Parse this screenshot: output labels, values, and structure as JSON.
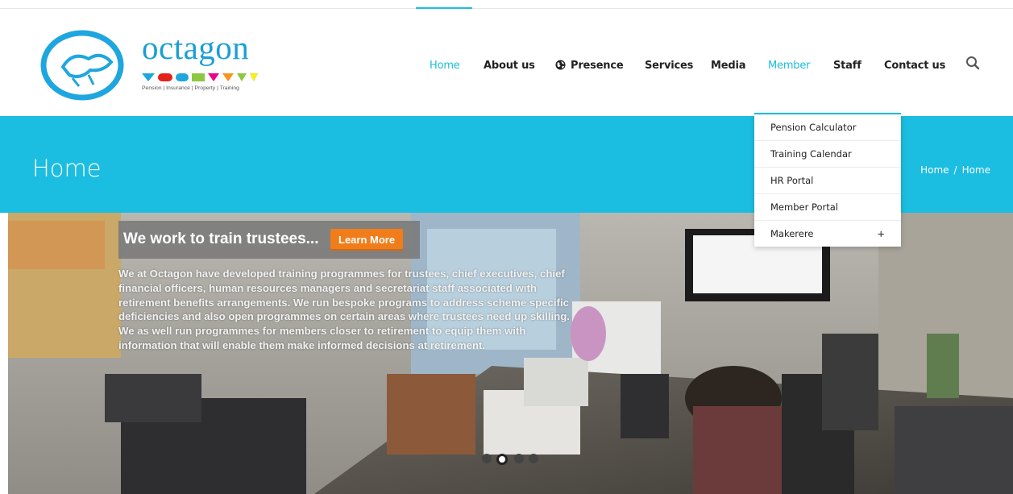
{
  "logo": {
    "word": "octagon",
    "tagline": "Pension | Insurance | Property | Training"
  },
  "nav": {
    "items": [
      {
        "label": "Home"
      },
      {
        "label": "About us"
      },
      {
        "label": "Presence",
        "icon": "globe-icon"
      },
      {
        "label": "Services"
      },
      {
        "label": "Media"
      },
      {
        "label": "Member"
      },
      {
        "label": "Staff"
      },
      {
        "label": "Contact us"
      }
    ],
    "search_icon": "search-icon"
  },
  "band": {
    "title": "Home",
    "breadcrumb": [
      "Home",
      "Home"
    ],
    "separator": "/"
  },
  "dropdown": {
    "items": [
      {
        "label": "Pension Calculator"
      },
      {
        "label": "Training Calendar"
      },
      {
        "label": "HR Portal"
      },
      {
        "label": "Member Portal"
      },
      {
        "label": "Makerere",
        "expand": "+"
      }
    ]
  },
  "slider": {
    "title": "We work to train trustees...",
    "button_label": "Learn More",
    "body": "We at Octagon have developed training programmes for trustees, chief executives, chief financial officers, human resources managers and secretariat staff associated with retirement benefits arrangements. We run bespoke programs to address scheme specific deficiencies and also open programmes on certain areas where trustees need up skilling. We as well run programmes for members closer to retirement to equip them with information that will enable them make informed decisions at retirement.",
    "dots": 4,
    "active_dot": 2
  },
  "colors": {
    "accent": "#1bbde0",
    "button": "#f07d1a",
    "logo_blue": "#1a9fd4"
  }
}
